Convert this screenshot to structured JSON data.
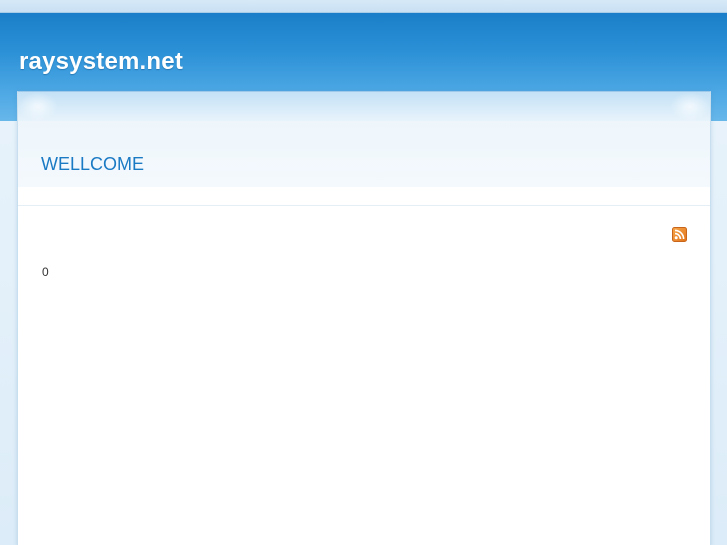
{
  "header": {
    "site_title": "raysystem.net"
  },
  "main": {
    "heading": "WELLCOME",
    "count_text": "0"
  },
  "icons": {
    "feed": "rss-feed-icon"
  },
  "colors": {
    "header_blue": "#2b90d6",
    "heading_blue": "#1b7ac4",
    "rss_orange": "#f08a24"
  }
}
